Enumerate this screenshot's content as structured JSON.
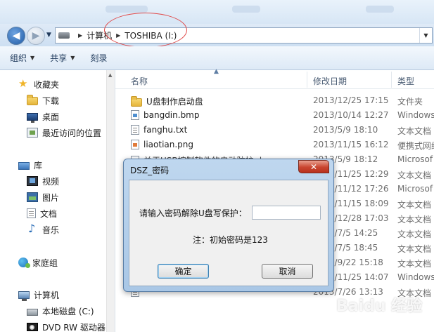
{
  "address_bar": {
    "crumbs": [
      "计算机",
      "TOSHIBA (I:)"
    ]
  },
  "toolbar": {
    "organize": "组织",
    "share": "共享",
    "burn": "刻录"
  },
  "nav_pane": {
    "favorites": "收藏夹",
    "downloads": "下载",
    "desktop": "桌面",
    "recent": "最近访问的位置",
    "libraries": "库",
    "videos": "视频",
    "pictures": "图片",
    "documents": "文档",
    "music": "音乐",
    "homegroup": "家庭组",
    "computer": "计算机",
    "local_disk": "本地磁盘 (C:)",
    "dvd_drive": "DVD RW 驱动器"
  },
  "columns": {
    "name": "名称",
    "date": "修改日期",
    "type": "类型"
  },
  "files": [
    {
      "name": "U盘制作启动盘",
      "date": "2013/12/25 17:15",
      "type": "文件夹",
      "icon": "folder-icon"
    },
    {
      "name": "bangdin.bmp",
      "date": "2013/10/14 12:27",
      "type": "Windows",
      "icon": "bmp-file-icon"
    },
    {
      "name": "fanghu.txt",
      "date": "2013/5/9 18:10",
      "type": "文本文档",
      "icon": "text-file-icon"
    },
    {
      "name": "liaotian.png",
      "date": "2013/11/15 16:12",
      "type": "便携式网络",
      "icon": "png-file-icon"
    },
    {
      "name": "关于USB控制软件的启动防护.doc",
      "date": "2013/5/9 18:12",
      "type": "Microsof",
      "icon": "word-file-icon"
    },
    {
      "name": "",
      "date": "2013/11/25 12:29",
      "type": "文本文档",
      "icon": ""
    },
    {
      "name": "",
      "date": "2013/11/12 17:26",
      "type": "Microsof",
      "icon": ""
    },
    {
      "name": "",
      "date": "2013/11/15 18:09",
      "type": "文本文档",
      "icon": ""
    },
    {
      "name": "",
      "date": "2013/12/28 17:03",
      "type": "文本文档",
      "icon": ""
    },
    {
      "name": "",
      "date": "2013/7/5 14:25",
      "type": "文本文档",
      "icon": ""
    },
    {
      "name": "",
      "date": "2013/7/5 18:45",
      "type": "文本文档",
      "icon": ""
    },
    {
      "name": "",
      "date": "2013/9/22 15:18",
      "type": "文本文档",
      "icon": ""
    },
    {
      "name": "",
      "date": "2013/11/25 14:07",
      "type": "Windows",
      "icon": ""
    },
    {
      "name": "",
      "date": "2013/7/26 13:13",
      "type": "文本文档",
      "icon": ""
    }
  ],
  "dialog": {
    "title": "DSZ_密码",
    "close_glyph": "✕",
    "prompt": "请输入密码解除U盘写保护：",
    "password_value": "",
    "note": "注：初始密码是123",
    "ok": "确定",
    "cancel": "取消"
  },
  "watermark": "Baidu 经验",
  "colors": {
    "annotation_ellipse": "#e04b4b",
    "dialog_frame": "#a9c7e6",
    "close_button": "#c9452f"
  }
}
